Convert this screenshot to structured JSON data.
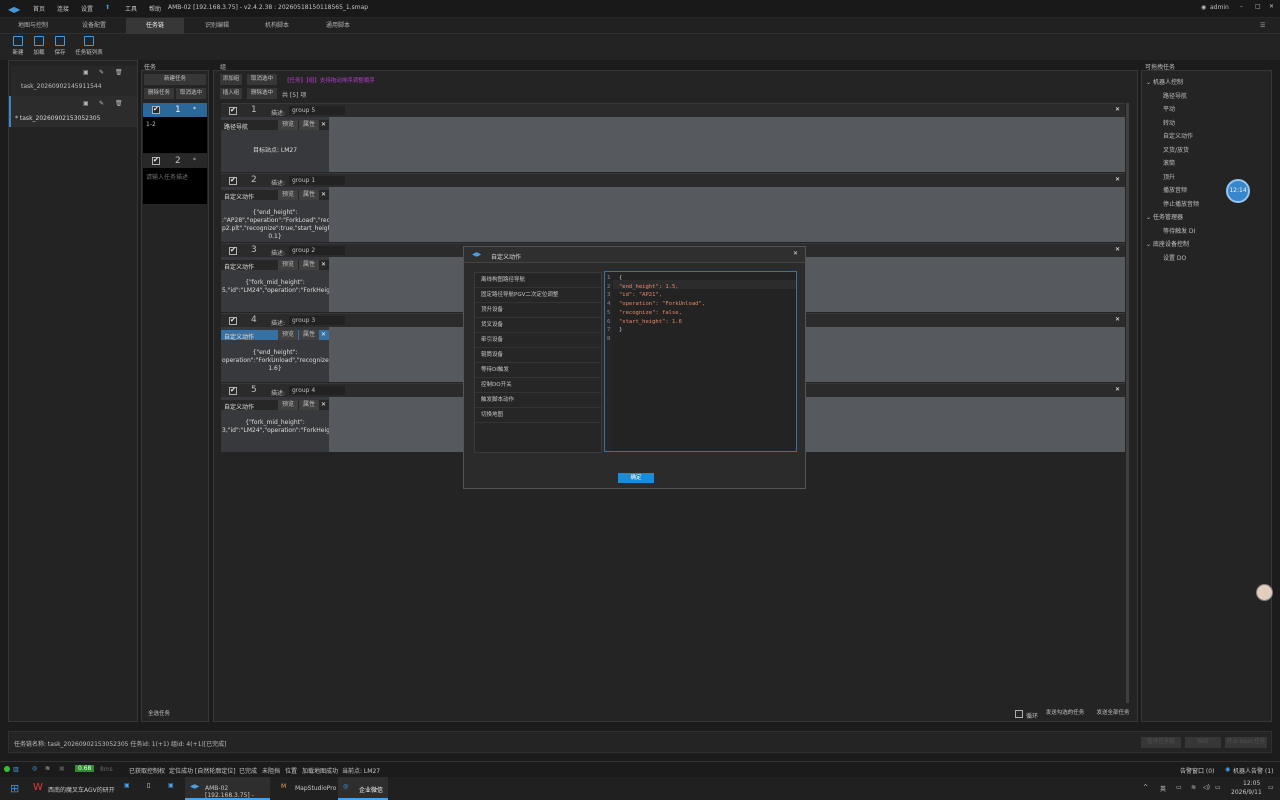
{
  "titlebar": {
    "menus": [
      "首页",
      "连接",
      "设置",
      "工具",
      "帮助"
    ],
    "title": "AMB-02 [192.168.3.75] - v2.4.2.38 : 20260518150118565_1.smap",
    "user": "admin"
  },
  "tabs": [
    "地图与控制",
    "设备配置",
    "任务链",
    "识别编辑",
    "机构脚本",
    "通用脚本"
  ],
  "toolbar": {
    "new": "新建",
    "load": "加载",
    "save": "保存",
    "tasklist": "任务链列表"
  },
  "tasklist": {
    "items": [
      {
        "name": "task_20260902145911544"
      },
      {
        "name": "* task_20260902153052305"
      }
    ]
  },
  "tasks_panel": {
    "label": "任务",
    "new_task": "新建任务",
    "delete_task": "删除任务",
    "cancel_select": "取消选中",
    "select_all": "全选任务",
    "tasks": [
      {
        "num": "1",
        "star": "*",
        "desc": "1-2"
      },
      {
        "num": "2",
        "star": "*",
        "desc": "请输入任务描述"
      }
    ]
  },
  "groups_panel": {
    "label": "组",
    "add_group": "添加组",
    "cancel_select": "取消选中",
    "hint1": "【任务】【组】支持拖动排序调整顺序",
    "insert_group": "插入组",
    "delete_selected": "删除选中",
    "total": "共 [5] 项",
    "desc_label": "描述:",
    "preview": "预览",
    "attr": "属性",
    "loop": "循环",
    "send_selected": "发送勾选的任务",
    "send_all": "发送全部任务",
    "groups": [
      {
        "num": "1",
        "desc": "group 5",
        "card_title": "路径导航",
        "card_text": "目标站点:   LM27"
      },
      {
        "num": "2",
        "desc": "group 1",
        "card_title": "自定义动作",
        "card_text": "{\"end_height\": :\"AP28\",\"operation\":\"ForkLoad\",\"recfi p2.plt\",\"recognize\":true,\"start_height\": 0.1}"
      },
      {
        "num": "3",
        "desc": "group 2",
        "card_title": "自定义动作",
        "card_text": "{\"fork_mid_height\": 5,\"id\":\"LM24\",\"operation\":\"ForkHeigh"
      },
      {
        "num": "4",
        "desc": "group 3",
        "card_title": "自定义动作",
        "card_text": "{\"end_height\": operation\":\"ForkUnload\",\"recognize\":f 1.6}"
      },
      {
        "num": "5",
        "desc": "group 4",
        "card_title": "自定义动作",
        "card_text": "{\"fork_mid_height\": 3,\"id\":\"LM24\",\"operation\":\"ForkHeigh"
      }
    ]
  },
  "dialog": {
    "title": "自定义动作",
    "list": [
      "离线构图路径导航",
      "固定路径导航PGV二次定位调整",
      "顶升设备",
      "货叉设备",
      "牵引设备",
      "辊筒设备",
      "等待DI触发",
      "控制DO开关",
      "触发脚本动作",
      "切换地图"
    ],
    "code_lines": [
      "{",
      "  \"end_height\": 1.5,",
      "  \"id\": \"AP21\",",
      "  \"operation\": \"ForkUnload\",",
      "  \"recognize\": false,",
      "  \"start_height\": 1.6",
      "}",
      ""
    ],
    "confirm": "确定"
  },
  "right_panel": {
    "title": "可拖拽任务",
    "sections": [
      {
        "name": "机器人控制",
        "items": [
          "路径导航",
          "平动",
          "转动",
          "自定义动作",
          "叉货/放货",
          "滚筒",
          "顶升",
          "播放音频",
          "停止播放音频"
        ]
      },
      {
        "name": "任务管理器",
        "items": [
          "等待触发 DI"
        ]
      },
      {
        "name": "底座设备控制",
        "items": [
          "设置 DO"
        ]
      }
    ],
    "time_badge": "12:14"
  },
  "chain_bar": {
    "text": "任务链名称:   task_20260902153052305  任务id: 1(+1) 组id: 4(+1)[已完成]",
    "btn1": "暂停任务链",
    "btn2": "继续",
    "btn3": "终止 Next 任务"
  },
  "statusbar": {
    "items": [
      "已获取控制权",
      "定位成功 [自然轮廓定位]",
      "已完成",
      "未阻挡",
      "位置",
      "加载地图成功",
      "当前点: LM27"
    ],
    "fps": "0.68",
    "ms": "8ms",
    "msg_count": "告警窗口 (0)",
    "robot_alarm": "机器人告警 (1)"
  },
  "taskbar": {
    "apps": [
      "西南的魔叉车AGV的研开",
      "AMB-02 [192.168.3.75] -",
      "MapStudioPro",
      "企业微信"
    ],
    "time": "12:05",
    "date": "2026/9/11",
    "ime": "英"
  }
}
